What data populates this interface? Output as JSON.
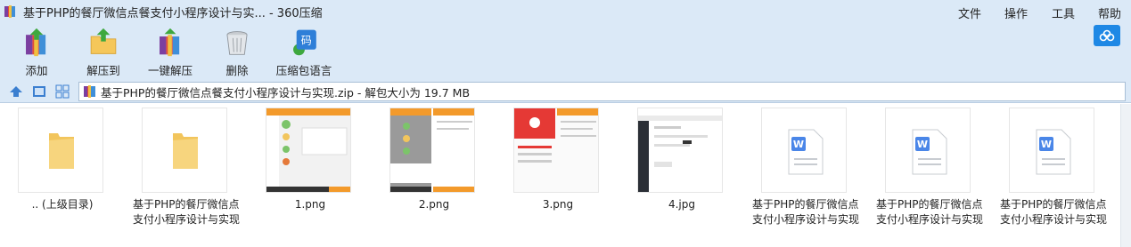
{
  "window": {
    "title": "基于PHP的餐厅微信点餐支付小程序设计与实... - 360压缩",
    "menu": [
      "文件",
      "操作",
      "工具",
      "帮助"
    ]
  },
  "toolbar": {
    "add": "添加",
    "extract_to": "解压到",
    "one_click_extract": "一键解压",
    "delete": "删除",
    "archive_language": "压缩包语言",
    "language_glyph": "码"
  },
  "address": {
    "text": "基于PHP的餐厅微信点餐支付小程序设计与实现.zip - 解包大小为 19.7 MB"
  },
  "files": [
    {
      "line1": ".. (上级目录)",
      "line2": "",
      "type": "folder"
    },
    {
      "line1": "基于PHP的餐厅微信点餐",
      "line2": "支付小程序设计与实现...",
      "type": "folder"
    },
    {
      "line1": "1.png",
      "line2": "",
      "type": "image"
    },
    {
      "line1": "2.png",
      "line2": "",
      "type": "image"
    },
    {
      "line1": "3.png",
      "line2": "",
      "type": "image"
    },
    {
      "line1": "4.jpg",
      "line2": "",
      "type": "image"
    },
    {
      "line1": "基于PHP的餐厅微信点餐",
      "line2": "支付小程序设计与实现...",
      "type": "word"
    },
    {
      "line1": "基于PHP的餐厅微信点餐",
      "line2": "支付小程序设计与实现...",
      "type": "word"
    },
    {
      "line1": "基于PHP的餐厅微信点餐",
      "line2": "支付小程序设计与实现...",
      "type": "word"
    }
  ],
  "colors": {
    "chrome": "#dbe9f7",
    "accent_orange": "#f39a2b",
    "word_blue": "#4a86e8"
  }
}
